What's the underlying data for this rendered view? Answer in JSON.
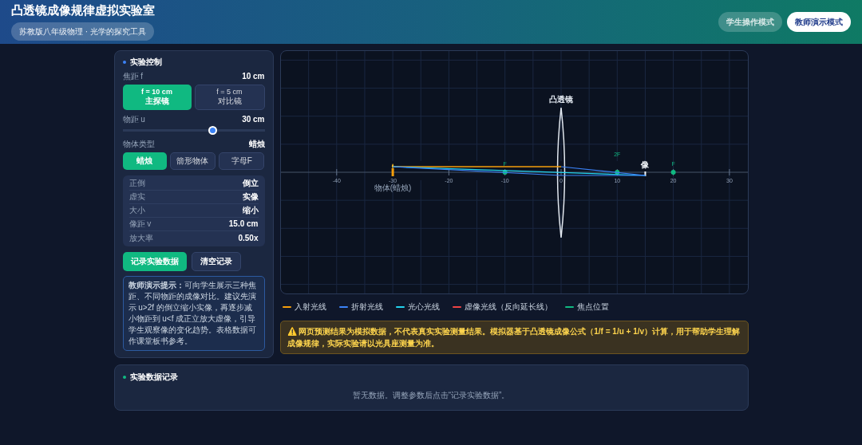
{
  "header": {
    "title": "凸透镜成像规律虚拟实验室",
    "subtitle": "苏教版八年级物理 · 光学的探究工具",
    "modes": [
      {
        "label": "学生操作模式",
        "selected": false
      },
      {
        "label": "教师演示模式",
        "selected": true
      }
    ]
  },
  "controls": {
    "title": "实验控制",
    "focal": {
      "label": "焦距 f",
      "value": "10 cm",
      "options": [
        {
          "main": "f = 10 cm",
          "sub": "主探镜",
          "selected": true
        },
        {
          "main": "f = 5 cm",
          "sub": "对比镜",
          "selected": false
        }
      ]
    },
    "distance": {
      "label": "物距 u",
      "value": "30 cm",
      "level": 0.63
    },
    "object_type": {
      "label": "物体类型",
      "value": "蜡烛",
      "options": [
        {
          "label": "蜡烛",
          "selected": true
        },
        {
          "label": "箭形物体",
          "selected": false
        },
        {
          "label": "字母F",
          "selected": false
        }
      ]
    },
    "results": [
      {
        "label": "正倒",
        "value": "倒立"
      },
      {
        "label": "虚实",
        "value": "实像"
      },
      {
        "label": "大小",
        "value": "缩小"
      },
      {
        "label": "像距 v",
        "value": "15.0 cm"
      },
      {
        "label": "放大率",
        "value": "0.50x"
      }
    ],
    "buttons": [
      {
        "label": "记录实验数据",
        "kind": "primary"
      },
      {
        "label": "清空记录",
        "kind": "secondary"
      }
    ],
    "tip": "**教师演示提示：**可向学生展示三种焦距、不同物距的成像对比。建议先演示 u>2f 的倒立缩小实像，再逐步减小物距到 u<f 成正立放大虚像，引导学生观察像的变化趋势。表格数据可作课堂板书参考。"
  },
  "diagram": {
    "lens_label": "凸透镜",
    "object_label": "物体(蜡烛)",
    "image_label": "像",
    "focus_labels": [
      "F",
      "2F",
      "F"
    ],
    "axis_ticks": [
      "-40",
      "-30",
      "-20",
      "-10",
      "0",
      "10",
      "20",
      "30"
    ]
  },
  "legend": [
    {
      "label": "入射光线",
      "color": "#f59e0b"
    },
    {
      "label": "折射光线",
      "color": "#3b82f6"
    },
    {
      "label": "光心光线",
      "color": "#22d3ee"
    },
    {
      "label": "虚像光线（反向延长线）",
      "color": "#ef4444"
    },
    {
      "label": "焦点位置",
      "color": "#10b981"
    }
  ],
  "warning": "⚠️ 网页预测结果为模拟数据，不代表真实实验测量结果。模拟器基于凸透镜成像公式（1/f = 1/u + 1/v）计算，用于帮助学生理解成像规律，实际实验请以光具座测量为准。",
  "records": {
    "title": "实验数据记录",
    "empty": "暂无数据。调整参数后点击“记录实验数据”。"
  }
}
